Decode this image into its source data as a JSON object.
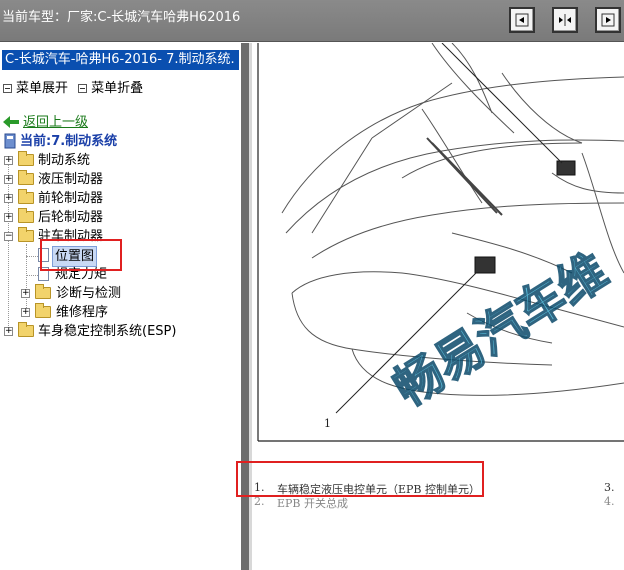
{
  "window": {
    "title": "当前车型：厂家:C-长城汽车哈弗H62016"
  },
  "toolbar": {
    "buttons": [
      {
        "icon": "collapse-left-icon"
      },
      {
        "icon": "split-view-icon"
      },
      {
        "icon": "collapse-right-icon"
      }
    ]
  },
  "sidebar": {
    "breadcrumb": "C-长城汽车-哈弗H6-2016- 7.制动系统.",
    "expand_label": "菜单展开",
    "collapse_label": "菜单折叠",
    "back_label": "返回上一级",
    "current_label": "当前:7.制动系统",
    "items": [
      {
        "label": "制动系统",
        "type": "folder"
      },
      {
        "label": "液压制动器",
        "type": "folder"
      },
      {
        "label": "前轮制动器",
        "type": "folder"
      },
      {
        "label": "后轮制动器",
        "type": "folder"
      },
      {
        "label": "驻车制动器",
        "type": "folder-open"
      },
      {
        "label": "位置图",
        "type": "doc",
        "selected": true
      },
      {
        "label": "规定力矩",
        "type": "doc"
      },
      {
        "label": "诊断与检测",
        "type": "folder"
      },
      {
        "label": "维修程序",
        "type": "folder"
      },
      {
        "label": "车身稳定控制系统(ESP)",
        "type": "folder"
      }
    ]
  },
  "diagram": {
    "callout_number": "1",
    "watermark": "畅易汽车维",
    "captions": [
      {
        "num": "1.",
        "text": "车辆稳定液压电控单元（EPB 控制单元）"
      },
      {
        "num": "2.",
        "text": "EPB 开关总成"
      },
      {
        "num": "3.",
        "text": ""
      },
      {
        "num": "4.",
        "text": ""
      }
    ]
  },
  "colors": {
    "breadcrumb_bg": "#0a4fb0",
    "highlight_red": "#e02020",
    "link_green": "#1a7a1a",
    "current_blue": "#1a3fa8"
  }
}
